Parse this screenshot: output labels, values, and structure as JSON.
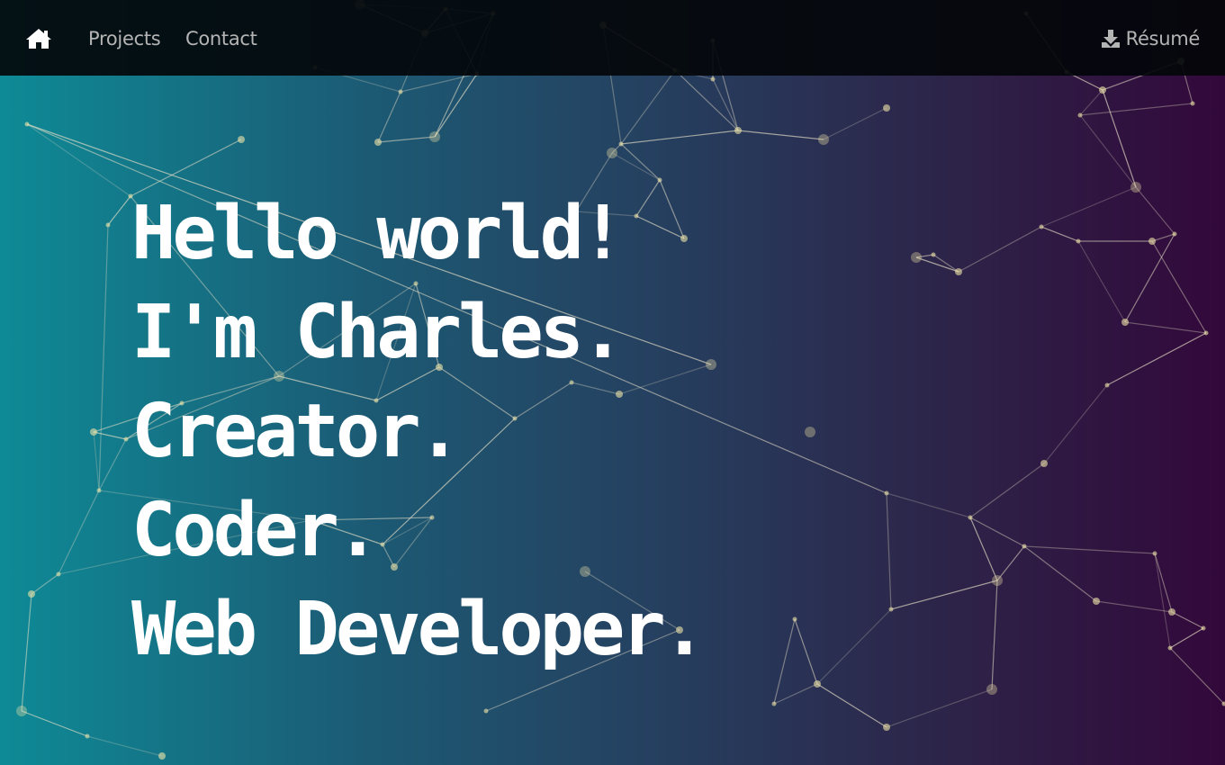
{
  "nav": {
    "home_icon": "home-icon",
    "links": [
      "Projects",
      "Contact"
    ],
    "resume_label": "Résumé",
    "resume_icon": "download-icon"
  },
  "hero": {
    "lines": [
      "Hello world!",
      "I'm Charles.",
      "Creator.",
      "Coder.",
      "Web Developer."
    ]
  },
  "colors": {
    "gradient_start": "#0e8a96",
    "gradient_end": "#32083a",
    "navbar_bg": "#03060a",
    "nav_text": "#b4b4b4",
    "hero_text": "#ffffff",
    "network_line": "#e8e0c8",
    "network_node": "#f0e6a8"
  }
}
